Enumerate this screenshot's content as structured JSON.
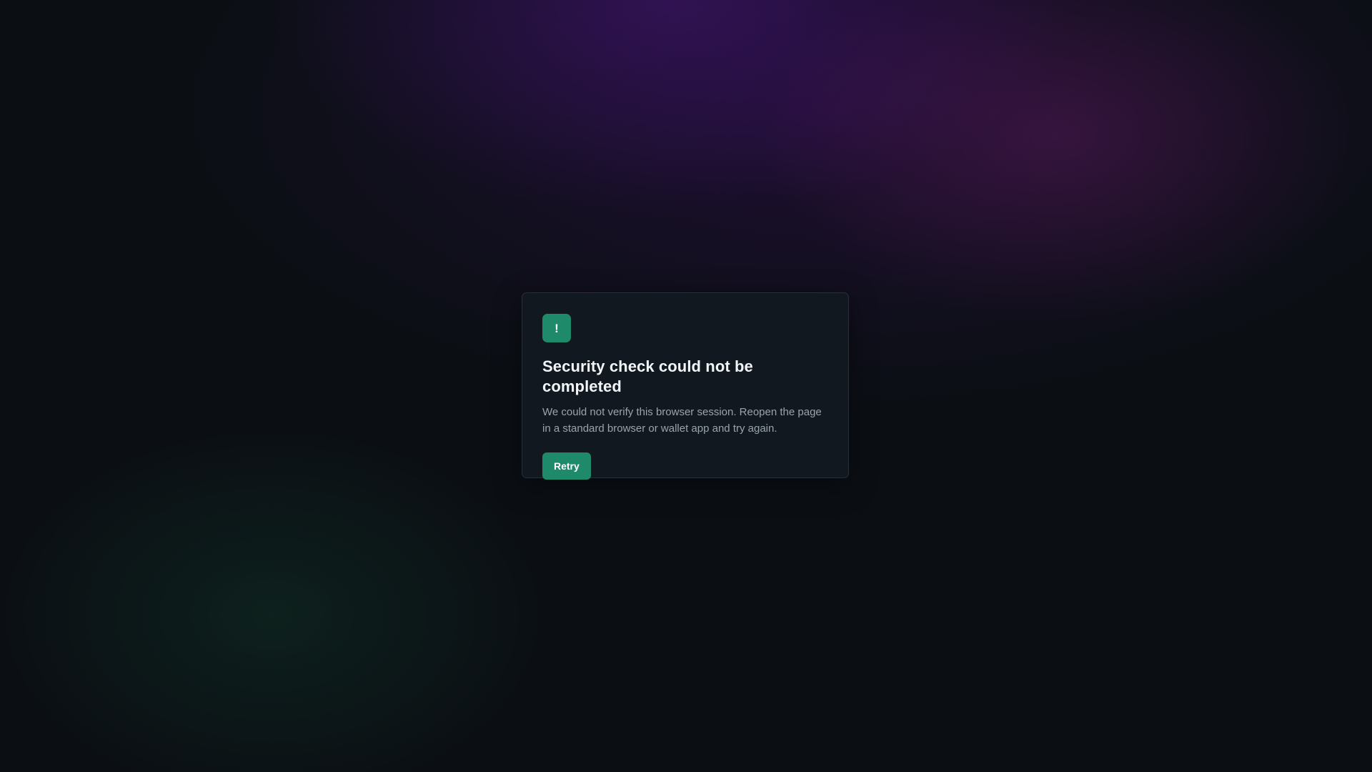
{
  "card": {
    "icon": {
      "name": "exclamation-icon",
      "glyph": "!",
      "color": "#1f8a6a"
    },
    "title": "Security check could not be completed",
    "message": "We could not verify this browser session. Reopen the page in a standard browser or wallet app and try again.",
    "retry_label": "Retry"
  },
  "colors": {
    "accent": "#1f8a6a",
    "background": "#0b0f14",
    "card": "#111820"
  }
}
